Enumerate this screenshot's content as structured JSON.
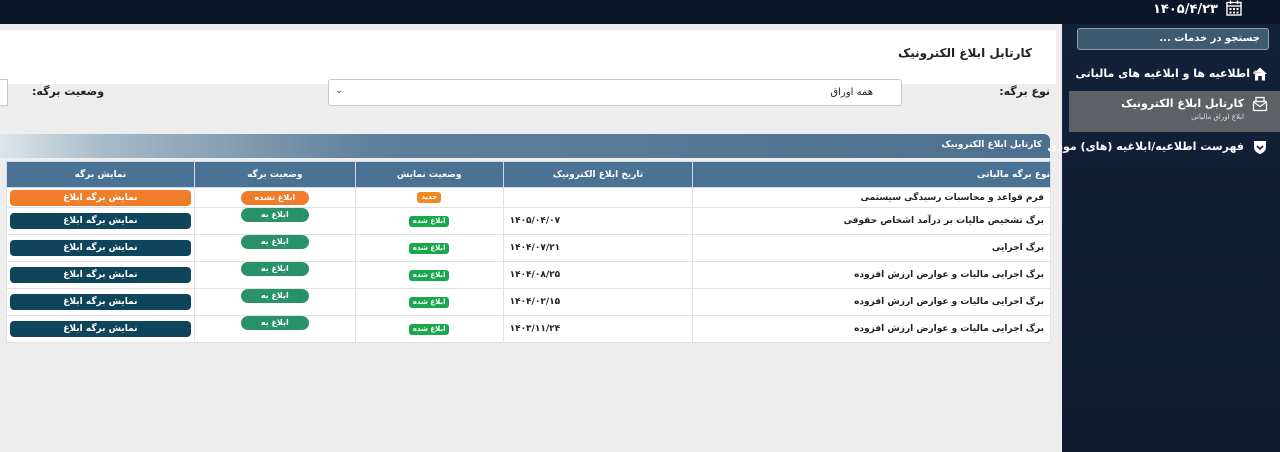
{
  "header": {
    "date": "۱۴۰۵/۴/۲۳"
  },
  "page": {
    "title": "کارتابل ابلاغ الکترونیک"
  },
  "filters": {
    "sheet_type_label": "نوع برگه:",
    "sheet_type_value": "همه اوراق",
    "sheet_status_label": "وضعیت برگه:"
  },
  "grid": {
    "title": "کارتابل ابلاغ الکترونیک",
    "columns": [
      "نوع برگه مالیاتی",
      "تاریخ ابلاغ الکترونیک",
      "وضعیت نمایش",
      "وضعیت برگه",
      "نمایش برگه"
    ],
    "rows": [
      {
        "type": "فرم قواعد و محاسبات رسیدگی سیستمی",
        "date": "",
        "display": "جدید",
        "status": "ابلاغ نشده",
        "action": "نمایش برگه ابلاغ"
      },
      {
        "type": "برگ تشخیص مالیات بر درآمد اشخاص حقوقی",
        "date": "۱۴۰۵/۰۴/۰۷",
        "display": "ابلاغ شده",
        "status": "ابلاغ به مودی",
        "action": "نمایش برگه ابلاغ"
      },
      {
        "type": "برگ اجرایی",
        "date": "۱۴۰۴/۰۷/۲۱",
        "display": "ابلاغ شده",
        "status": "ابلاغ به مودی",
        "action": "نمایش برگه ابلاغ"
      },
      {
        "type": "برگ اجرایی مالیات و عوارض ارزش افزوده",
        "date": "۱۴۰۴/۰۸/۲۵",
        "display": "ابلاغ شده",
        "status": "ابلاغ به مودی",
        "action": "نمایش برگه ابلاغ"
      },
      {
        "type": "برگ اجرایی مالیات و عوارض ارزش افزوده",
        "date": "۱۴۰۴/۰۲/۱۵",
        "display": "ابلاغ شده",
        "status": "ابلاغ به مودی",
        "action": "نمایش برگه ابلاغ"
      },
      {
        "type": "برگ اجرایی مالیات و عوارض ارزش افزوده",
        "date": "۱۴۰۳/۱۱/۲۴",
        "display": "ابلاغ شده",
        "status": "ابلاغ به مودی",
        "action": "نمایش برگه ابلاغ"
      }
    ]
  },
  "sidebar": {
    "search_placeholder": "جستجو در خدمات ...",
    "items": [
      {
        "label": "اطلاعیه ها و ابلاغیه های مالیاتی",
        "icon": "home-icon"
      },
      {
        "label": "کارتابل ابلاغ الکترونیک",
        "sub": "ابلاغ اوراق مالیاتی",
        "icon": "mail-icon"
      },
      {
        "label": "فهرست اطلاعیه/ابلاغیه (های) مودی",
        "icon": "shield-icon"
      }
    ]
  },
  "colors": {
    "header_blue": "#4a7294",
    "badge_green": "#1aa84f",
    "badge_orange": "#f08a22",
    "pill_teal": "#29926b",
    "button_dark": "#0f455a",
    "button_orange": "#ef7d2a",
    "sidebar_bg": "#0f1c33"
  }
}
